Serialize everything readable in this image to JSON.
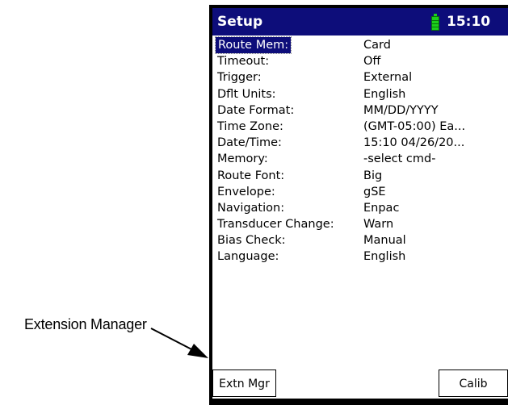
{
  "callout": {
    "text": "Extension Manager"
  },
  "header": {
    "title": "Setup",
    "time": "15:10",
    "battery_icon": "battery-icon"
  },
  "settings": [
    {
      "label": "Route Mem:",
      "value": "Card",
      "selected": true
    },
    {
      "label": "Timeout:",
      "value": "Off"
    },
    {
      "label": "Trigger:",
      "value": "External"
    },
    {
      "label": "Dflt Units:",
      "value": "English"
    },
    {
      "label": "Date Format:",
      "value": "MM/DD/YYYY"
    },
    {
      "label": "Time Zone:",
      "value": "(GMT-05:00) Ea..."
    },
    {
      "label": "Date/Time:",
      "value": "15:10 04/26/20..."
    },
    {
      "label": "Memory:",
      "value": "-select cmd-"
    },
    {
      "label": "Route Font:",
      "value": "Big"
    },
    {
      "label": "Envelope:",
      "value": "gSE"
    },
    {
      "label": "Navigation:",
      "value": "Enpac"
    },
    {
      "label": "Transducer Change:",
      "value": "Warn"
    },
    {
      "label": "Bias Check:",
      "value": "Manual"
    },
    {
      "label": "Language:",
      "value": "English"
    }
  ],
  "softkeys": {
    "left": "Extn Mgr",
    "right": "Calib"
  },
  "colors": {
    "titlebar": "#0d0d7a",
    "battery": "#1bd01b"
  }
}
